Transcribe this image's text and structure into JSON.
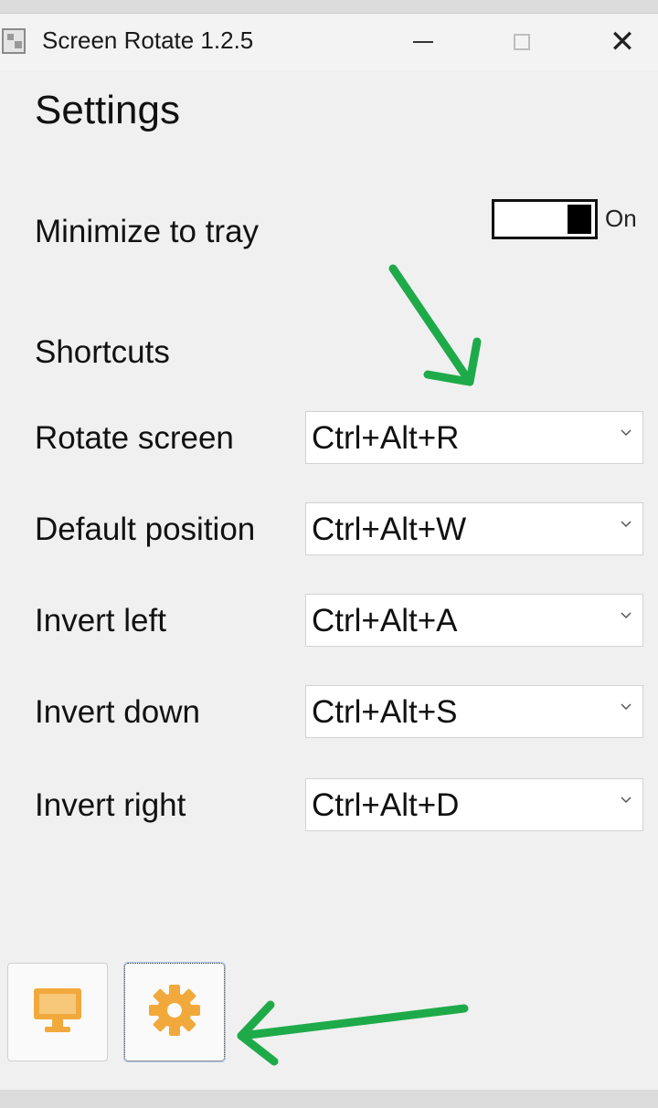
{
  "window": {
    "title": "Screen Rotate 1.2.5",
    "minimize_icon": "minimize-icon",
    "maximize_icon": "maximize-icon",
    "close_icon": "close-icon",
    "close_glyph": "✕"
  },
  "settings": {
    "heading": "Settings",
    "minimize_to_tray": {
      "label": "Minimize to tray",
      "state": "On",
      "enabled": true
    },
    "shortcuts_heading": "Shortcuts",
    "shortcuts": [
      {
        "label": "Rotate screen",
        "value": "Ctrl+Alt+R"
      },
      {
        "label": "Default position",
        "value": "Ctrl+Alt+W"
      },
      {
        "label": "Invert left",
        "value": "Ctrl+Alt+A"
      },
      {
        "label": "Invert down",
        "value": "Ctrl+Alt+S"
      },
      {
        "label": "Invert right",
        "value": "Ctrl+Alt+D"
      }
    ]
  },
  "bottom_nav": [
    {
      "icon": "monitor-icon",
      "color": "#f2a93b"
    },
    {
      "icon": "gear-icon",
      "color": "#f2a93b",
      "selected": true
    }
  ],
  "annotations": {
    "arrow_color": "#1faa4a"
  }
}
